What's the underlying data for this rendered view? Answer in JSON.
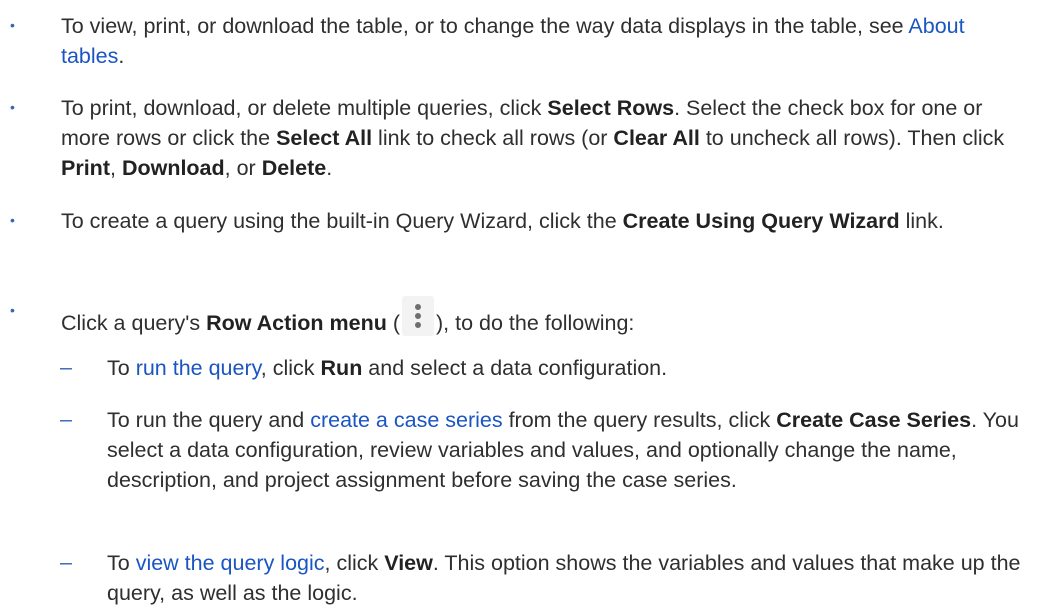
{
  "bullets": {
    "b1": {
      "t1": "To view, print, or download the table, or to change the way data displays in the table, see ",
      "link": "About tables",
      "t2": "."
    },
    "b2": {
      "t1": "To print, download, or delete multiple queries, click ",
      "bold1": "Select Rows",
      "t2": ". Select the check box for one or more rows or click the ",
      "bold2": "Select All",
      "t3": " link to check all rows (or ",
      "bold3": "Clear All",
      "t4": " to uncheck all rows). Then click ",
      "bold4": "Print",
      "t5": ", ",
      "bold5": "Download",
      "t6": ", or ",
      "bold6": "Delete",
      "t7": "."
    },
    "b3": {
      "t1": "To create a query using the built-in Query Wizard, click the ",
      "bold1": "Create Using Query Wizard",
      "t2": " link."
    },
    "b4": {
      "t1": "Click a query's ",
      "bold1": "Row Action menu",
      "t2": " (",
      "t3": "), to do the following:"
    }
  },
  "subitems": {
    "s1": {
      "t1": "To ",
      "link": "run the query",
      "t2": ", click ",
      "bold1": "Run",
      "t3": " and select a data configuration."
    },
    "s2": {
      "t1": "To run the query and ",
      "link": "create a case series",
      "t2": " from the query results, click ",
      "bold1": "Create Case Series",
      "t3": ". You select a data configuration, review variables and values, and optionally change the name, description, and project assignment before saving the case series."
    },
    "s3": {
      "t1": "To ",
      "link": "view the query logic",
      "t2": ", click ",
      "bold1": "View",
      "t3": ". This option shows the variables and values that make up the query, as well as the logic."
    }
  },
  "symbols": {
    "bullet": "•",
    "dash": "–"
  },
  "icons": {
    "row_action": "kebab-vertical-icon"
  }
}
